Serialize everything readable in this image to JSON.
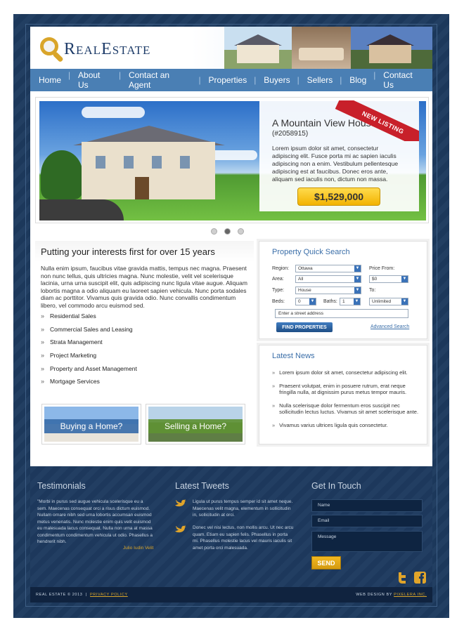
{
  "header": {
    "logo_text": "RealEstate"
  },
  "nav": {
    "items": [
      "Home",
      "About Us",
      "Contact an Agent",
      "Properties",
      "Buyers",
      "Sellers",
      "Blog",
      "Contact Us"
    ]
  },
  "featured": {
    "badge": "NEW LISTING",
    "title": "A Mountain View House",
    "ref": "(#2058915)",
    "description": "Lorem ipsum dolor sit amet, consectetur adipiscing elit. Fusce porta mi ac sapien iaculis adipiscing non a enim. Vestibulum pellentesque adipiscing est at faucibus. Donec eros ante, aliquam sed iaculis non, dictum non massa.",
    "price": "$1,529,000"
  },
  "intro": {
    "headline": "Putting your interests first for over 15 years",
    "body": "Nulla enim ipsum, faucibus vitae gravida mattis, tempus nec magna. Praesent non nunc tellus, quis ultricies magna. Nunc molestie, velit vel scelerisque lacinia, urna urna suscipit elit, quis adipiscing nunc ligula vitae augue. Aliquam lobortis magna a odio aliquam eu laoreet sapien vehicula. Nunc porta sodales diam ac porttitor. Vivamus quis gravida odio. Nunc convallis condimentum libero, vel commodo arcu euismod sed.",
    "services": [
      "Residential Sales",
      "Commercial Sales and Leasing",
      "Strata Management",
      "Project Marketing",
      "Property and Asset Management",
      "Mortgage Services"
    ]
  },
  "cta": {
    "buying": "Buying a Home?",
    "selling": "Selling a Home?"
  },
  "search": {
    "title": "Property Quick Search",
    "region_label": "Region:",
    "region_value": "Ottawa",
    "area_label": "Area:",
    "area_value": "All",
    "type_label": "Type:",
    "type_value": "House",
    "beds_label": "Beds:",
    "beds_value": "0",
    "baths_label": "Baths:",
    "baths_value": "1",
    "price_from_label": "Price From:",
    "price_from_value": "$0",
    "to_label": "To:",
    "to_value": "Unlimited",
    "street_placeholder": "Enter a street address",
    "find_button": "FIND PROPERTIES",
    "advanced_link": "Advanced Search"
  },
  "news": {
    "title": "Latest News",
    "items": [
      "Lorem ipsum dolor sit amet, consectetur adipiscing elit.",
      "Praesent volutpat, enim in posuere rutrum, erat neque fringilla nulla, at dignissim purus metus tempor mauris.",
      "Nulla scelerisque dolor fermentum eros suscipit nec sollicitudin lectus luctus. Vivamus sit amet scelerisque ante.",
      "Vivamus varius ultrices ligula quis consectetur."
    ]
  },
  "footer": {
    "testimonials_title": "Testimonials",
    "testimonial_text": "\"Morbi in purus sed augue vehicula scelerisque eu a sem. Maecenas consequat orci a risus dictum euismod. Nullam ornare nibh sed urna lobortis accumsan euismod metus venenatis. Nunc molestie enim quis velit euismod eu malesuada lacus consequat. Nulla non urna at massa condimentum condimentum vehicula ut odio. Phasellus a hendrerit nibh.",
    "testimonial_author": "Julio Iudin Velit",
    "tweets_title": "Latest Tweets",
    "tweets": [
      "Ligula ut purus tempus semper id sit amet neque. Maecenas velit magna, elementum in sollicitudin in, sollicitudin at orci.",
      "Donec vel nisi lectus, non mollis arcu. Ut nec arcu quam. Etiam eu sapien felis. Phasellus in porta mi. Phasellus molestie lacus vel mauris iaculis sit amet porta orci malesuada."
    ],
    "contact_title": "Get In Touch",
    "name_placeholder": "Name",
    "email_placeholder": "Email",
    "message_placeholder": "Message",
    "send_button": "SEND"
  },
  "bottom": {
    "copyright": "REAL ESTATE © 2013",
    "privacy": "PRIVACY POLICY",
    "credit_prefix": "WEB DESIGN BY",
    "credit_link": "PIXELERA INC."
  },
  "colors": {
    "brand_blue": "#1d3a5e",
    "nav_blue": "#4a7fb4",
    "accent_gold": "#d9a52a",
    "ribbon_red": "#c8202a"
  }
}
